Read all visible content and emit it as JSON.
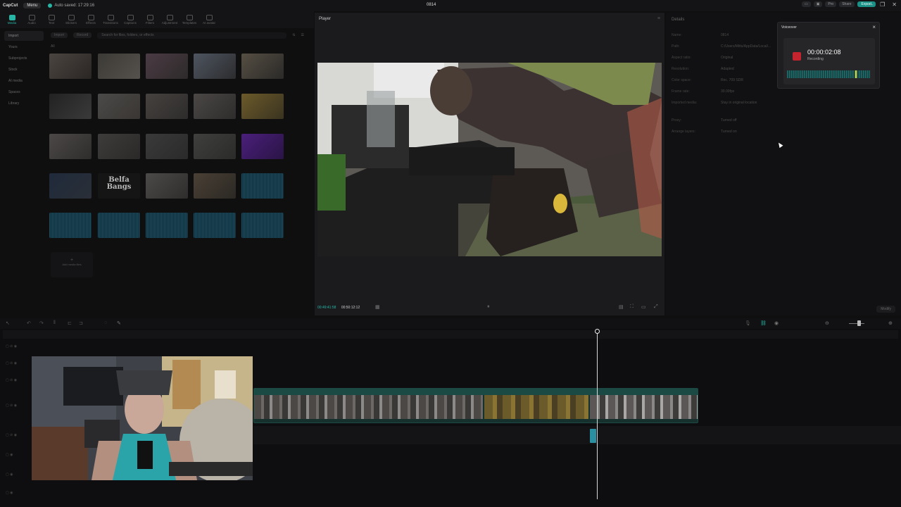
{
  "titlebar": {
    "logo": "CapCut",
    "menu": "Menu",
    "autosave": "Auto saved: 17:29:16",
    "title": "0814",
    "buttons": [
      "Pro",
      "Share",
      "Export"
    ],
    "window_controls": [
      "—",
      "❐",
      "✕"
    ]
  },
  "toolbar": {
    "items": [
      {
        "label": "Media",
        "active": true
      },
      {
        "label": "Audio"
      },
      {
        "label": "Text"
      },
      {
        "label": "Stickers"
      },
      {
        "label": "Effects"
      },
      {
        "label": "Transitions"
      },
      {
        "label": "Captions"
      },
      {
        "label": "Filters"
      },
      {
        "label": "Adjustment"
      },
      {
        "label": "Templates"
      },
      {
        "label": "AI avatar"
      }
    ]
  },
  "sidebar": {
    "items": [
      "Import",
      "Yours",
      "Subprojects",
      "Stock",
      "AI media",
      "Spaces",
      "Library"
    ]
  },
  "media": {
    "import_label": "Import",
    "record_label": "Record",
    "search_placeholder": "Search for files, folders, or effects",
    "all_label": "All",
    "add_label": "Add media files",
    "brand_text_1": "Belfa",
    "brand_text_2": "Bangs"
  },
  "player": {
    "title": "Player",
    "current_time": "00:49:41:58",
    "duration": "00:50:12:12"
  },
  "details": {
    "title": "Details",
    "rows": [
      {
        "k": "Name:",
        "v": "0814"
      },
      {
        "k": "Path:",
        "v": "C:/Users/Mitts/AppData/Local/..."
      },
      {
        "k": "Aspect ratio:",
        "v": "Original"
      },
      {
        "k": "Resolution:",
        "v": "Adapted"
      },
      {
        "k": "Color space:",
        "v": "Rec. 709 SDR"
      },
      {
        "k": "Frame rate:",
        "v": "30.00fps"
      },
      {
        "k": "Imported media:",
        "v": "Stay in original location"
      },
      {
        "k": "Proxy:",
        "v": "Turned off"
      },
      {
        "k": "Arrange layers:",
        "v": "Turned on"
      }
    ],
    "modify_label": "Modify"
  },
  "voiceover": {
    "title": "Voiceover",
    "timecode": "00:00:02:08",
    "status": "Recording",
    "level": 0.82
  },
  "colors": {
    "accent": "#27b6a5",
    "record": "#c4242e",
    "peak": "#e8d22a"
  }
}
